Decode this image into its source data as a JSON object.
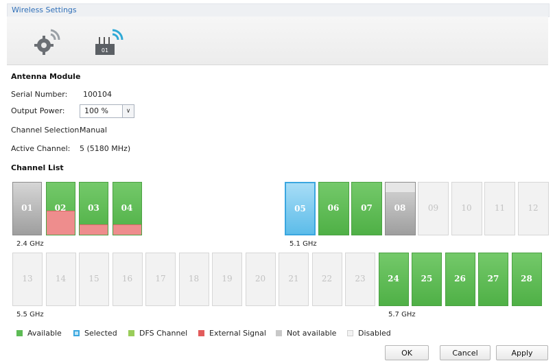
{
  "window": {
    "title": "Wireless Settings"
  },
  "toolbar": {
    "icons": [
      "gear-wireless-icon",
      "antenna-module-icon"
    ],
    "module_badge": "01"
  },
  "antenna": {
    "heading": "Antenna Module",
    "serial_label": "Serial Number:",
    "serial_value": "100104",
    "power_label": "Output Power:",
    "power_value": "100 %",
    "selection_label": "Channel Selection:",
    "selection_value": "Manual",
    "active_label": "Active Channel:",
    "active_value": "5 (5180 MHz)"
  },
  "channel_list": {
    "heading": "Channel List",
    "bands": [
      "2.4 GHz",
      "5.1 GHz",
      "5.5 GHz",
      "5.7 GHz"
    ],
    "row1_left": [
      {
        "num": "01",
        "state": "na",
        "ext": 0
      },
      {
        "num": "02",
        "state": "avail",
        "ext": 0.45
      },
      {
        "num": "03",
        "state": "avail",
        "ext": 0.18
      },
      {
        "num": "04",
        "state": "avail",
        "ext": 0.18
      }
    ],
    "row1_right": [
      {
        "num": "05",
        "state": "sel"
      },
      {
        "num": "06",
        "state": "avail"
      },
      {
        "num": "07",
        "state": "avail"
      },
      {
        "num": "08",
        "state": "na",
        "notavail_top": true
      },
      {
        "num": "09",
        "state": "dis"
      },
      {
        "num": "10",
        "state": "dis"
      },
      {
        "num": "11",
        "state": "dis"
      },
      {
        "num": "12",
        "state": "dis"
      }
    ],
    "row2": [
      {
        "num": "13",
        "state": "dis"
      },
      {
        "num": "14",
        "state": "dis"
      },
      {
        "num": "15",
        "state": "dis"
      },
      {
        "num": "16",
        "state": "dis"
      },
      {
        "num": "17",
        "state": "dis"
      },
      {
        "num": "18",
        "state": "dis"
      },
      {
        "num": "19",
        "state": "dis"
      },
      {
        "num": "20",
        "state": "dis"
      },
      {
        "num": "21",
        "state": "dis"
      },
      {
        "num": "22",
        "state": "dis"
      },
      {
        "num": "23",
        "state": "dis"
      },
      {
        "num": "24",
        "state": "avail"
      },
      {
        "num": "25",
        "state": "avail"
      },
      {
        "num": "26",
        "state": "avail"
      },
      {
        "num": "27",
        "state": "avail"
      },
      {
        "num": "28",
        "state": "avail"
      }
    ]
  },
  "legend": [
    {
      "label": "Available",
      "color": "#5dbb55"
    },
    {
      "label": "Selected",
      "color": "#5cbce9"
    },
    {
      "label": "DFS Channel",
      "color": "#9acd5a"
    },
    {
      "label": "External Signal",
      "color": "#e25c5c"
    },
    {
      "label": "Not available",
      "color": "#c8c8c8"
    },
    {
      "label": "Disabled",
      "color": "#f2f2f2"
    }
  ],
  "buttons": {
    "ok": "OK",
    "cancel": "Cancel",
    "apply": "Apply"
  }
}
